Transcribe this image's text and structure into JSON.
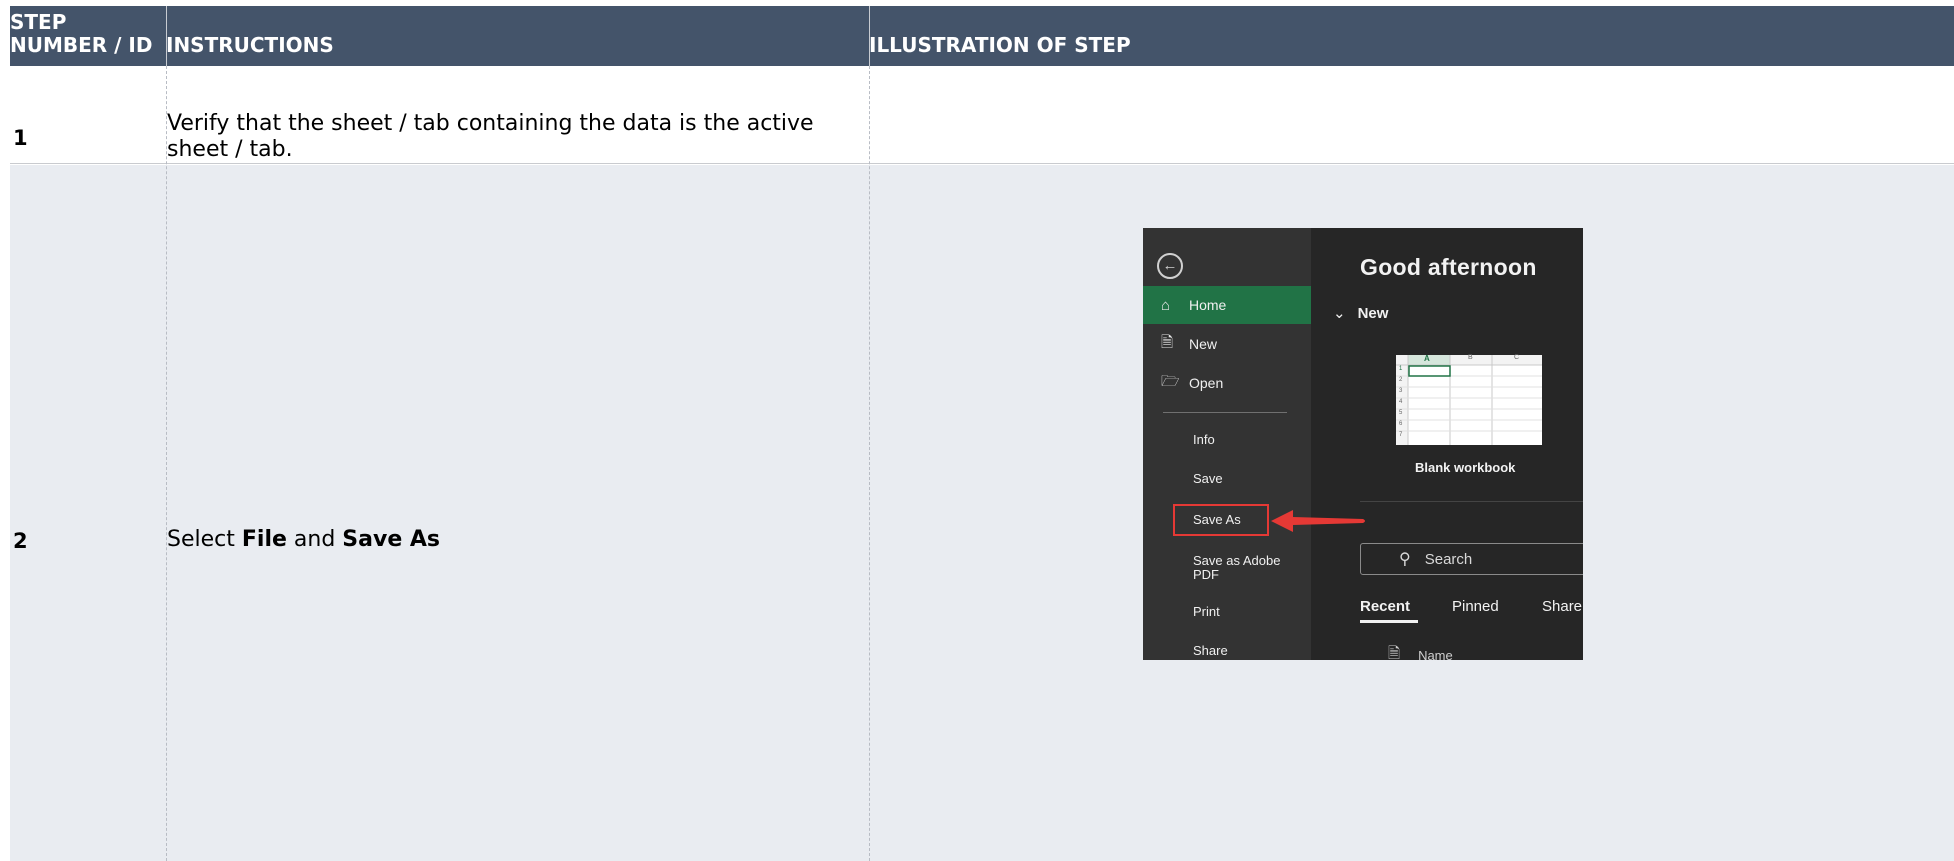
{
  "header": {
    "col1": "STEP NUMBER / ID",
    "col1_line1": "STEP",
    "col1_line2": "NUMBER / ID",
    "col2": "INSTRUCTIONS",
    "col3": "ILLUSTRATION OF STEP"
  },
  "rows": [
    {
      "step": "1",
      "instruction": "Verify that the sheet / tab containing the data is the active sheet / tab.",
      "instruction_line1": "Verify that the sheet / tab containing the data is the active",
      "instruction_line2": "sheet / tab."
    },
    {
      "step": "2",
      "instruction_parts": [
        "Select ",
        "File",
        " and ",
        "Save As"
      ]
    }
  ],
  "illustration": {
    "greeting": "Good afternoon",
    "new_section": "New",
    "nav_items": [
      {
        "label": "Home",
        "icon": "home-icon"
      },
      {
        "label": "New",
        "icon": "new-file-icon"
      },
      {
        "label": "Open",
        "icon": "folder-open-icon"
      },
      {
        "label": "Info"
      },
      {
        "label": "Save"
      },
      {
        "label": "Save As"
      },
      {
        "label": "Save as Adobe PDF"
      },
      {
        "label": "Print"
      },
      {
        "label": "Share"
      }
    ],
    "thumbnail_label": "Blank workbook",
    "thumbnail_cols": [
      "A",
      "B",
      "C"
    ],
    "thumbnail_rows": [
      "1",
      "2",
      "3",
      "4",
      "5",
      "6",
      "7"
    ],
    "search_placeholder": "Search",
    "tabs": [
      "Recent",
      "Pinned",
      "Share"
    ],
    "column_header": "Name",
    "accent_color": "#217346",
    "highlight_color": "#e53935"
  }
}
